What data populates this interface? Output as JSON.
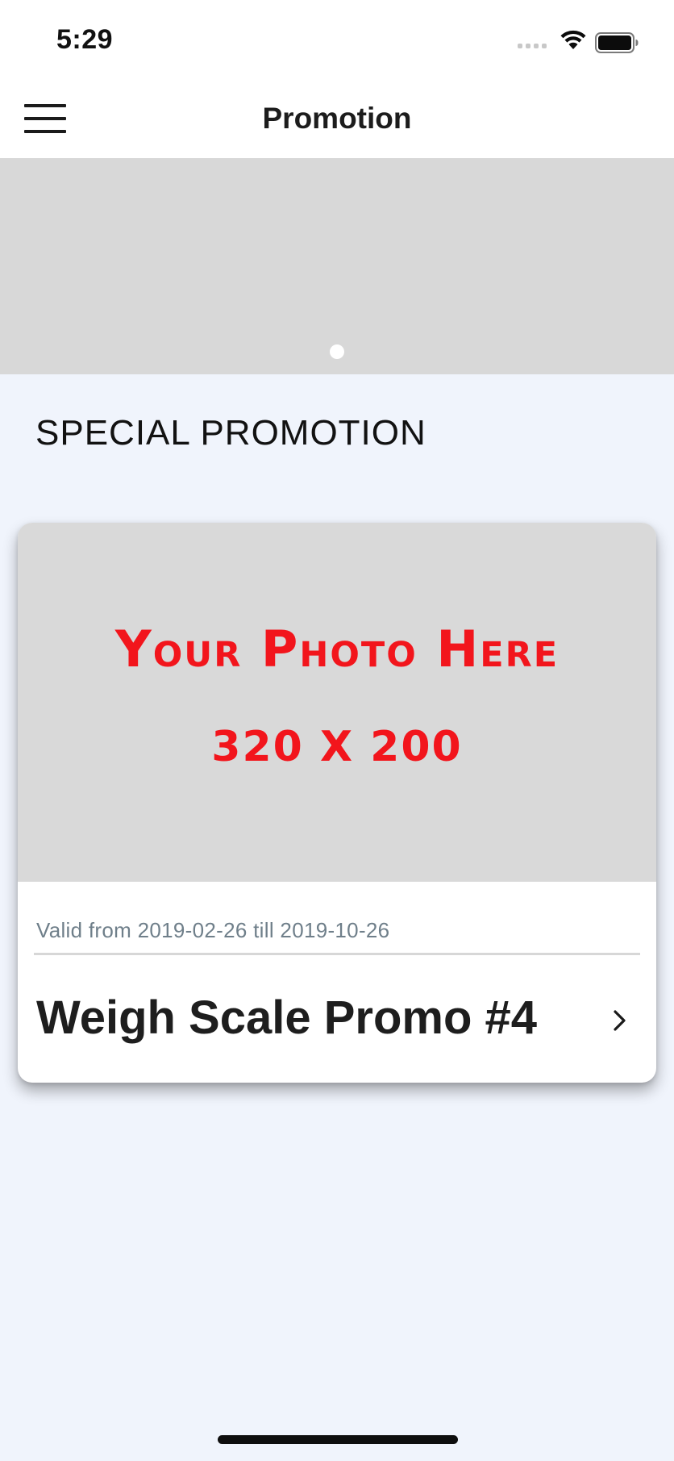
{
  "status_bar": {
    "time": "5:29",
    "icons": [
      "cellular-signal-icon",
      "wifi-icon",
      "battery-icon"
    ]
  },
  "nav": {
    "title": "Promotion",
    "menu_icon": "hamburger-menu-icon"
  },
  "banner": {
    "page_count": 1,
    "active_page": 1
  },
  "section": {
    "heading": "SPECIAL PROMOTION"
  },
  "promotions": [
    {
      "image_text_line1": "Your Photo Here",
      "image_text_line2": "320 X 200",
      "valid_text": "Valid from 2019-02-26 till 2019-10-26",
      "title": "Weigh Scale Promo #4",
      "chevron_icon": "chevron-right-icon"
    }
  ],
  "colors": {
    "background": "#f0f4fc",
    "banner": "#d8d8d8",
    "placeholder_text": "#f2151c",
    "valid_text": "#6f7f8a"
  }
}
